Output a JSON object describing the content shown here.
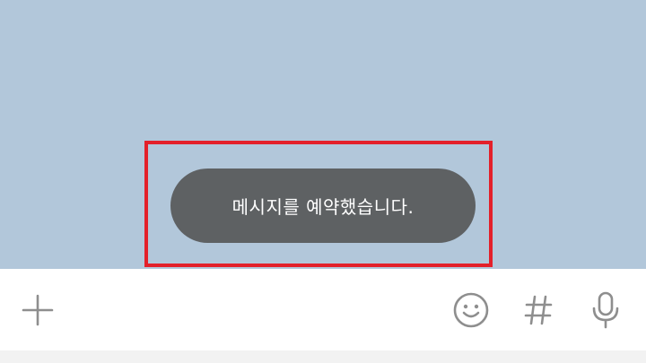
{
  "toast": {
    "message": "메시지를 예약했습니다."
  },
  "input_bar": {
    "icons": {
      "attach": "plus-icon",
      "emoji": "smiley-icon",
      "hashtag": "hash-icon",
      "voice": "microphone-icon"
    }
  },
  "colors": {
    "chat_background": "#b2c7da",
    "toast_background": "#5e6163",
    "highlight_border": "#e3202a",
    "icon_color": "#8e8e8e",
    "input_bar_background": "#ffffff"
  }
}
